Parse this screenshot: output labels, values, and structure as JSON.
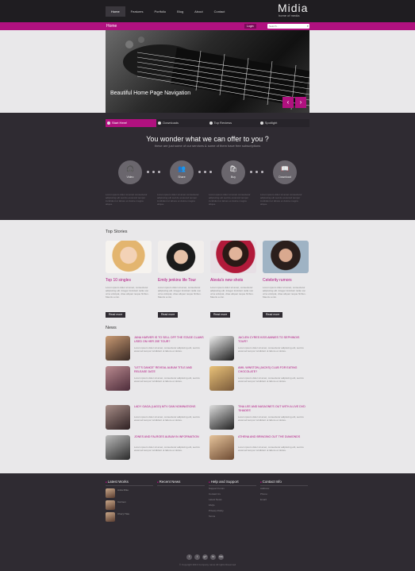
{
  "header": {
    "nav": [
      "Home",
      "Features",
      "Portfolio",
      "Blog",
      "About",
      "Contact"
    ],
    "logo_title": "Midia",
    "logo_sub": "home of media"
  },
  "subbar": {
    "crumb": "Home",
    "login": "Login",
    "search_placeholder": "Search..."
  },
  "hero": {
    "caption": "Beautiful Home Page Navigation"
  },
  "tabs": [
    "Start Here!",
    "Downloads",
    "Top Reviews",
    "Spotlight"
  ],
  "offer": {
    "title": "You wonder what we can offer to you ?",
    "subtitle": "these are just some of our services & some of them have free subscriptions",
    "items": [
      {
        "label": "Video",
        "icon": "headphones-icon",
        "glyph": "🎧"
      },
      {
        "label": "Share",
        "icon": "users-icon",
        "glyph": "👥"
      },
      {
        "label": "Buy",
        "icon": "shopping-bag-icon",
        "glyph": "🛍"
      },
      {
        "label": "Download",
        "icon": "book-icon",
        "glyph": "📖"
      }
    ],
    "col_text": "Lorem ipsum dolor sit amet consectetur adipiscing elit sed do eiusmod tempor incididunt ut labore et dolore magna aliqua."
  },
  "top_stories": {
    "title": "Top Stories",
    "items": [
      {
        "title": "Top 10 singles",
        "read": "Read more"
      },
      {
        "title": "Emily jenkins life Tour",
        "read": "Read more"
      },
      {
        "title": "Alesta's new shots",
        "read": "Read more"
      },
      {
        "title": "Celebrity rumors",
        "read": "Read more"
      }
    ],
    "body": "Lorem ipsum dolor sit amet, consectetur adipiscing elit. Integer tincidunt nulla non urna volutpat, vitae aliquet neque finibus. Mauris a nisi."
  },
  "news": {
    "title": "News",
    "items": [
      {
        "title": "JANA HARVER IS TO SELL OFF THE STAGE CLAWS USED ON HER 20E TOUR?",
        "read": "Read More..."
      },
      {
        "title": "JACLEN CYRES KISS AMNIES TO SEPHINOIS TOUR?",
        "read": "Read More..."
      },
      {
        "title": "\"LET'S DANCE\" REVEAL ALBUM TITLE AND RELEASE DATE",
        "read": "Read More..."
      },
      {
        "title": "AMIL WINSTON (JACKS) CLUB FOR EATING CHOCOLATE?",
        "read": "Read More..."
      },
      {
        "title": "LADY GAGA (LAGO) MTV GAN NOMINATIONS",
        "read": "Read More..."
      },
      {
        "title": "TINA LEE AND NASAONE'S OUT WITH A LIVE DVD 'SHADES'",
        "read": "Read More..."
      },
      {
        "title": "JONES AND FALROES ALBUM IN INFORMATION",
        "read": "Read More..."
      },
      {
        "title": "ATHENA AND BRINGING OUT THE DIAMONDS",
        "read": "Read More..."
      }
    ],
    "body": "Lorem ipsum dolor sit amet, consectetur adipiscing elit, sed do eiusmod tempor incididunt ut labore et dolore."
  },
  "footer": {
    "latest_works": {
      "title": "Latest Works",
      "people": [
        "Anita Mike",
        "Carmen",
        "Cheryl Tate"
      ]
    },
    "recent_news": {
      "title": "Recent News"
    },
    "help": {
      "title": "Help and Support",
      "links": [
        "Support Forum",
        "Contact Us",
        "Latest News",
        "FAQs",
        "Privacy Policy",
        "Terms"
      ]
    },
    "contact": {
      "title": "Contact Info",
      "address_label": "Address:",
      "phone_label": "Phone:",
      "email_label": "Email:"
    },
    "social": [
      "f",
      "t",
      "g+",
      "in",
      "rss"
    ],
    "copyright": "© Copyright 2013 Company name All rights Reserved"
  }
}
